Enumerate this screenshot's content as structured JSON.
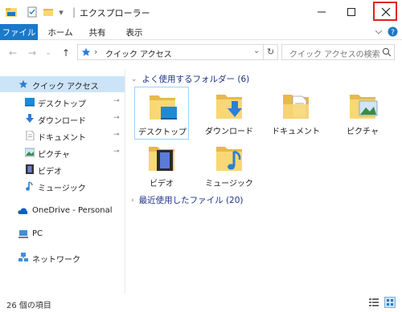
{
  "window": {
    "title": "エクスプローラー",
    "title_separator": "|",
    "minimize_glyph": "—",
    "maximize_glyph": "☐",
    "close_glyph": "✕"
  },
  "ribbon": {
    "tabs": [
      "ファイル",
      "ホーム",
      "共有",
      "表示"
    ],
    "expand_glyph": "⌄",
    "help_glyph": "?"
  },
  "address": {
    "back_glyph": "←",
    "forward_glyph": "→",
    "recent_glyph": "⌄",
    "up_glyph": "↑",
    "path": "クイック アクセス",
    "path_chevron": "›",
    "dropdown_glyph": "⌄",
    "refresh_glyph": "↻",
    "search_placeholder": "クイック アクセスの検索",
    "search_icon": "search-icon"
  },
  "sidebar": {
    "quick_access": "クイック アクセス",
    "items": [
      {
        "label": "デスクトップ",
        "pinned": true
      },
      {
        "label": "ダウンロード",
        "pinned": true
      },
      {
        "label": "ドキュメント",
        "pinned": true
      },
      {
        "label": "ピクチャ",
        "pinned": true
      },
      {
        "label": "ビデオ",
        "pinned": false
      },
      {
        "label": "ミュージック",
        "pinned": false
      }
    ],
    "pin_glyph": "📌",
    "onedrive": "OneDrive - Personal",
    "pc": "PC",
    "network": "ネットワーク"
  },
  "main": {
    "frequent_group": "よく使用するフォルダー (6)",
    "frequent_chevron": "⌄",
    "folders": [
      {
        "label": "デスクトップ",
        "icon": "desktop-folder"
      },
      {
        "label": "ダウンロード",
        "icon": "downloads-folder"
      },
      {
        "label": "ドキュメント",
        "icon": "documents-folder"
      },
      {
        "label": "ピクチャ",
        "icon": "pictures-folder"
      },
      {
        "label": "ビデオ",
        "icon": "videos-folder"
      },
      {
        "label": "ミュージック",
        "icon": "music-folder"
      }
    ],
    "recent_group": "最近使用したファイル (20)",
    "recent_chevron": "›"
  },
  "status": {
    "item_count": "26 個の項目"
  },
  "colors": {
    "accent": "#1979ca",
    "selection": "#cce4f7",
    "folder": "#f8d775",
    "folder_dark": "#e8b94a",
    "close_highlight": "#e02020"
  }
}
